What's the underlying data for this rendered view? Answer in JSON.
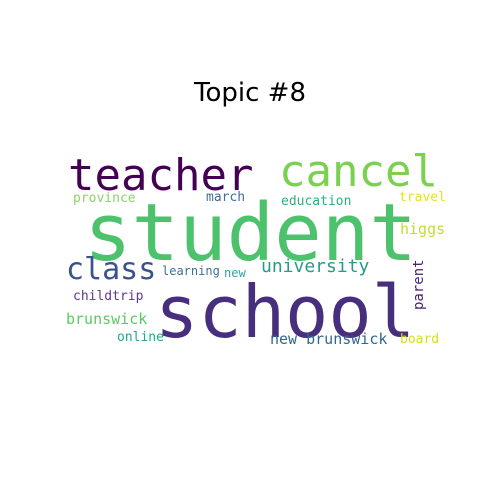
{
  "title": "Topic #8",
  "words": [
    {
      "text": "student",
      "color": "#4cc26c",
      "weight": 1.0
    },
    {
      "text": "school",
      "color": "#472f7d",
      "weight": 0.9
    },
    {
      "text": "teacher",
      "color": "#440154",
      "weight": 0.5
    },
    {
      "text": "cancel",
      "color": "#7ad151",
      "weight": 0.5
    },
    {
      "text": "class",
      "color": "#3b528b",
      "weight": 0.3
    },
    {
      "text": "university",
      "color": "#2a9a85",
      "weight": 0.25
    },
    {
      "text": "province",
      "color": "#8cd46c",
      "weight": 0.15
    },
    {
      "text": "march",
      "color": "#3e6fa0",
      "weight": 0.15
    },
    {
      "text": "education",
      "color": "#2bb07f",
      "weight": 0.15
    },
    {
      "text": "travel",
      "color": "#e7e31c",
      "weight": 0.15
    },
    {
      "text": "higgs",
      "color": "#c8dc2b",
      "weight": 0.18
    },
    {
      "text": "learning",
      "color": "#3f6e96",
      "weight": 0.13
    },
    {
      "text": "new",
      "color": "#2ea4a0",
      "weight": 0.13
    },
    {
      "text": "parent",
      "color": "#482173",
      "weight": 0.18
    },
    {
      "text": "childtrip",
      "color": "#5d3a8a",
      "weight": 0.14
    },
    {
      "text": "brunswick",
      "color": "#5ec962",
      "weight": 0.18
    },
    {
      "text": "new brunswick",
      "color": "#31688e",
      "weight": 0.18
    },
    {
      "text": "online",
      "color": "#22a884",
      "weight": 0.14
    },
    {
      "text": "board",
      "color": "#d5e21a",
      "weight": 0.14
    }
  ]
}
